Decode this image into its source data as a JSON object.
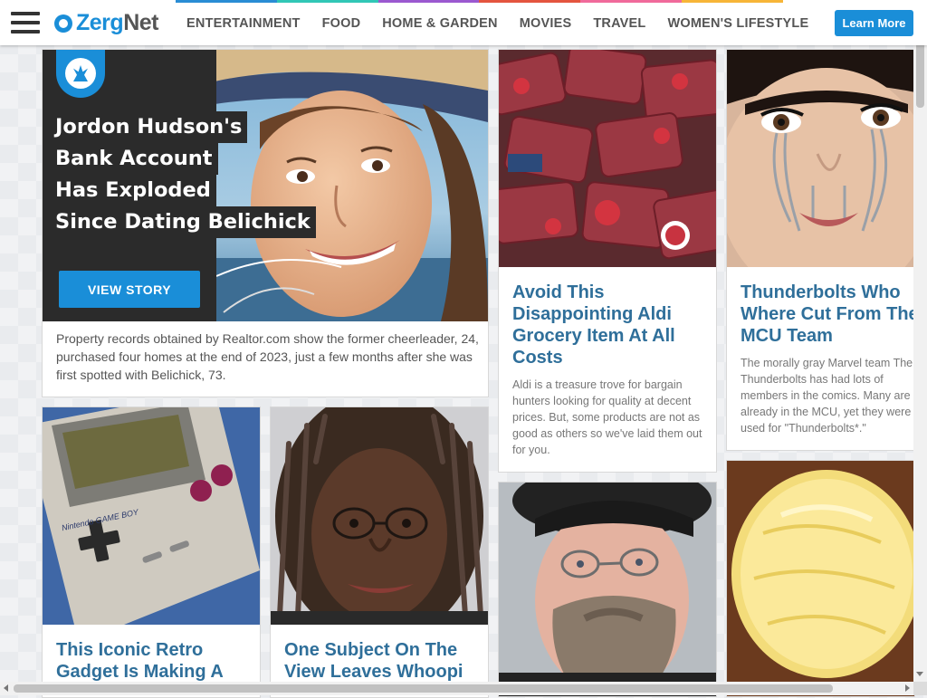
{
  "header": {
    "logo_text_a": "Zerg",
    "logo_text_b": "Net",
    "nav": [
      "ENTERTAINMENT",
      "FOOD",
      "HOME & GARDEN",
      "MOVIES",
      "TRAVEL",
      "WOMEN'S LIFESTYLE"
    ],
    "nav_colors": [
      "#2a8dd4",
      "#31c7b6",
      "#9b59d0",
      "#e4553f",
      "#f06a9b",
      "#f7b538"
    ],
    "cta": "Learn More"
  },
  "featured": {
    "headline_lines": [
      "Jordon Hudson's",
      "Bank Account",
      "Has Exploded",
      "Since Dating Belichick"
    ],
    "button": "VIEW STORY",
    "description": "Property records obtained by Realtor.com show the former cheerleader, 24, purchased four homes at the end of 2023, just a few months after she was first spotted with Belichick, 73."
  },
  "cards": {
    "aldi": {
      "title": "Avoid This Disappointing Aldi Grocery Item At All Costs",
      "description": "Aldi is a treasure trove for bargain hunters looking for quality at decent prices. But, some products are not as good as others so we've laid them out for you."
    },
    "thunderbolts": {
      "title": "Thunderbolts Who Where Cut From The MCU Team",
      "description": "The morally gray Marvel team The Thunderbolts has had lots of members in the comics. Many are already in the MCU, yet they were used for \"Thunderbolts*.\""
    },
    "gameboy": {
      "title": "This Iconic Retro Gadget Is Making A",
      "device_label": "Nintendo GAME BOY"
    },
    "whoopi": {
      "title": "One Subject On The View Leaves Whoopi"
    }
  },
  "image_icons": {
    "featured": "woman-in-sunhat-photo",
    "aldi": "packaged-meat-photo",
    "thunderbolts": "woman-with-metal-tears-photo",
    "gameboy": "game-boy-photo",
    "whoopi": "woman-with-dreadlocks-photo",
    "mythbuster": "man-with-beret-photo",
    "butter": "butter-photo"
  }
}
